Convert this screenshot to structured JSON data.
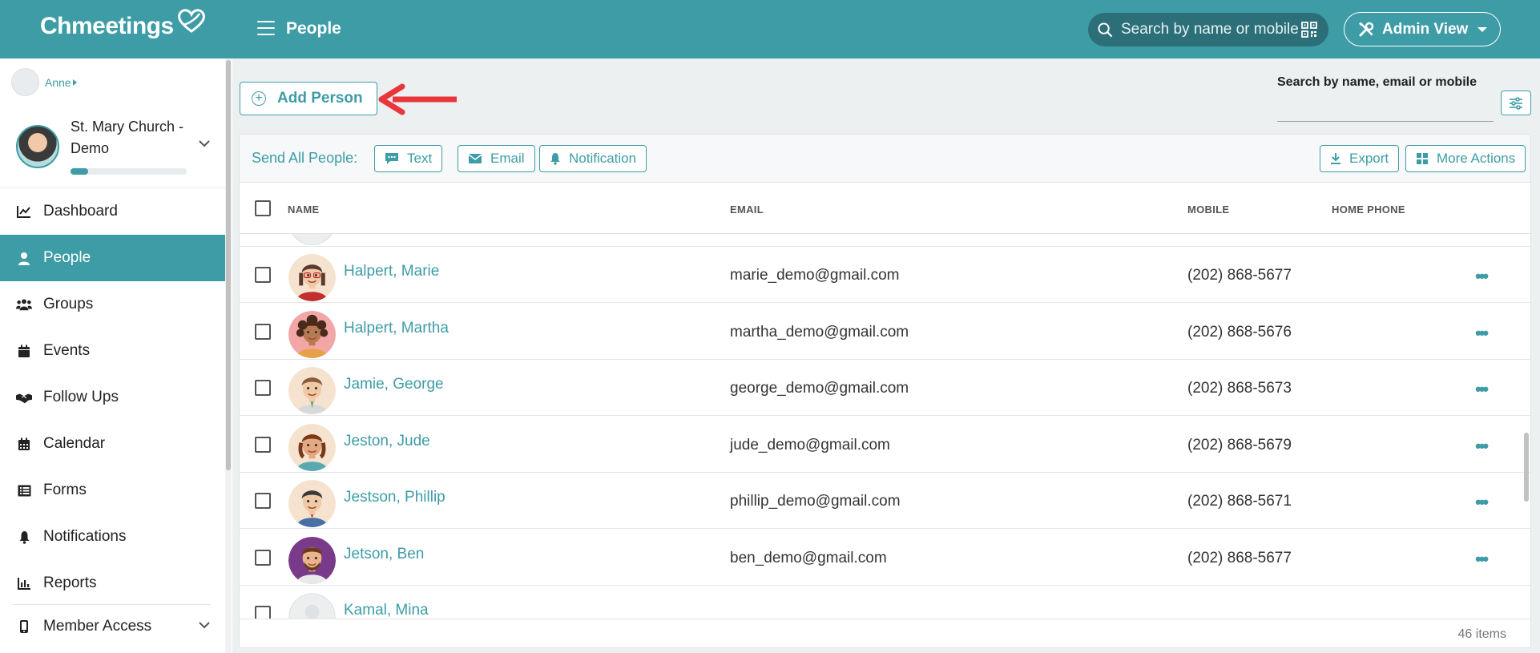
{
  "app": {
    "logo_text": "Chmeetings",
    "page_title": "People",
    "top_search_placeholder": "Search by name or mobile",
    "admin_view_label": "Admin View"
  },
  "sidebar": {
    "user_name": "Anne",
    "church_name": "St. Mary Church - Demo",
    "church_progress": 0.15,
    "items": [
      {
        "label": "Dashboard",
        "icon": "chart-line-icon",
        "active": false
      },
      {
        "label": "People",
        "icon": "person-icon",
        "active": true
      },
      {
        "label": "Groups",
        "icon": "users-icon",
        "active": false
      },
      {
        "label": "Events",
        "icon": "calendar-icon",
        "active": false
      },
      {
        "label": "Follow Ups",
        "icon": "handshake-icon",
        "active": false
      },
      {
        "label": "Calendar",
        "icon": "calendar-grid-icon",
        "active": false
      },
      {
        "label": "Forms",
        "icon": "list-icon",
        "active": false
      },
      {
        "label": "Notifications",
        "icon": "bell-icon",
        "active": false
      },
      {
        "label": "Reports",
        "icon": "bar-chart-icon",
        "active": false
      }
    ],
    "member_access": "Member Access"
  },
  "main": {
    "add_person_label": "Add Person",
    "search_label": "Search by name, email or mobile",
    "toolbar": {
      "send_all_label": "Send All People:",
      "text_label": "Text",
      "email_label": "Email",
      "notification_label": "Notification",
      "export_label": "Export",
      "more_actions_label": "More Actions"
    },
    "columns": {
      "name": "NAME",
      "email": "EMAIL",
      "mobile": "MOBILE",
      "home_phone": "HOME PHONE"
    },
    "rows": [
      {
        "name": "Halpert, Marie",
        "email": "marie_demo@gmail.com",
        "mobile": "(202) 868-5677"
      },
      {
        "name": "Halpert, Martha",
        "email": "martha_demo@gmail.com",
        "mobile": "(202) 868-5676"
      },
      {
        "name": "Jamie, George",
        "email": "george_demo@gmail.com",
        "mobile": "(202) 868-5673"
      },
      {
        "name": "Jeston, Jude",
        "email": "jude_demo@gmail.com",
        "mobile": "(202) 868-5679"
      },
      {
        "name": "Jestson, Phillip",
        "email": "phillip_demo@gmail.com",
        "mobile": "(202) 868-5671"
      },
      {
        "name": "Jetson, Ben",
        "email": "ben_demo@gmail.com",
        "mobile": "(202) 868-5677"
      },
      {
        "name": "Kamal, Mina",
        "email": "",
        "mobile": ""
      }
    ],
    "more_glyph": "•••",
    "items_count": "46 items"
  }
}
